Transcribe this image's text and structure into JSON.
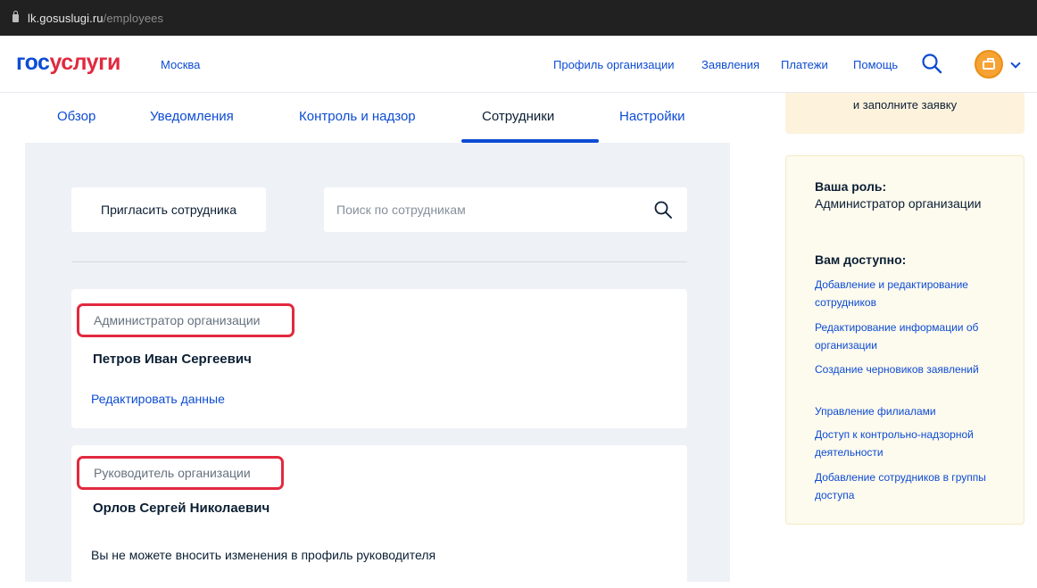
{
  "browser": {
    "url_domain": "lk.gosuslugi.ru",
    "url_path": "/employees"
  },
  "header": {
    "logo_part1": "гос",
    "logo_part2": "услуги",
    "city": "Москва",
    "nav": [
      "Профиль организации",
      "Заявления",
      "Платежи",
      "Помощь"
    ],
    "accent_color": "#0d4cd3",
    "brand_red": "#e2293f"
  },
  "tabs": {
    "items": [
      "Обзор",
      "Уведомления",
      "Контроль и надзор",
      "Сотрудники",
      "Настройки"
    ],
    "active": "Сотрудники"
  },
  "toolbar": {
    "invite_label": "Пригласить сотрудника",
    "search_placeholder": "Поиск по сотрудникам"
  },
  "employees": [
    {
      "role": "Администратор организации",
      "name": "Петров Иван Сергеевич",
      "action": "Редактировать данные"
    },
    {
      "role": "Руководитель организации",
      "name": "Орлов Сергей Николаевич",
      "note": "Вы не можете вносить изменения в профиль руководителя"
    }
  ],
  "sidebar": {
    "promo_text": "и заполните заявку",
    "role_heading": "Ваша роль:",
    "role_value": "Администратор организации",
    "access_heading": "Вам доступно:",
    "permissions": [
      "Добавление и редактирование сотрудников",
      "Редактирование информации об организации",
      "Создание черновиков заявлений",
      "Управление филиалами",
      "Доступ к контрольно-надзорной деятельности",
      "Добавление сотрудников в группы доступа"
    ]
  }
}
